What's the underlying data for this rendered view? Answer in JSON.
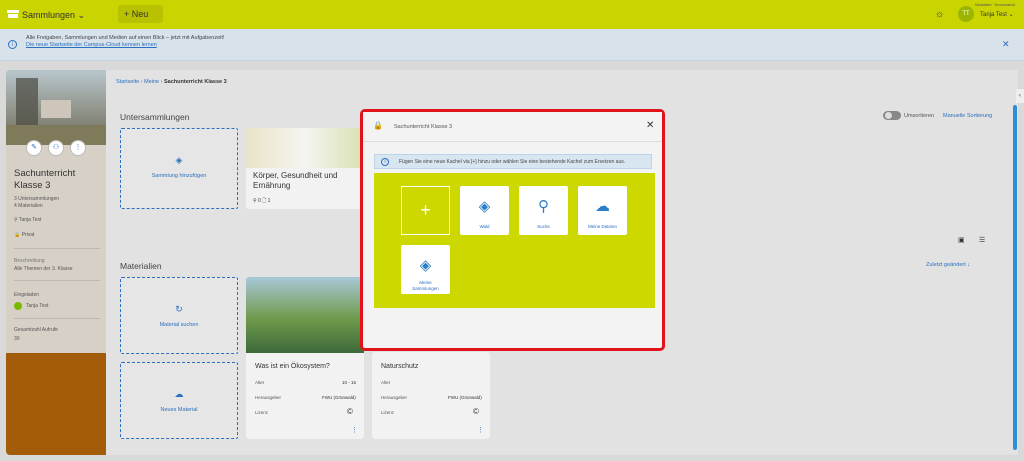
{
  "topbar": {
    "title": "Sammlungen ⌄",
    "new_label": "+  Neu",
    "user_initials": "TT",
    "user_name": "Tanja Test ⌄",
    "small_text": "Metadaten · Druckansicht"
  },
  "banner": {
    "line1": "Alle Freigaben, Sammlungen und Medien auf einen Blick – jetzt mit Aufgabenzeit!",
    "line2": "Die neue Startseite der Campus-Cloud kennen lernen"
  },
  "sidebar": {
    "title": "Sachunterricht Klasse 3",
    "counts": [
      "3 Untersammlungen",
      "4 Materialien"
    ],
    "owner": "Tanja Test",
    "visibility": "Privat",
    "description_label": "Beschreibung",
    "description": "Alle Themen der 3. Klasse",
    "invited_label": "Eingeladen",
    "invited_user": "Tanja Test",
    "views_label": "Gesamtzahl Aufrufe",
    "views": "30"
  },
  "breadcrumb": {
    "items": [
      "Startseite",
      "Meine"
    ],
    "current": "Sachunterricht Klasse 3"
  },
  "main": {
    "subcollections_heading": "Untersammlungen",
    "add_collection": "Sammlung hinzufügen",
    "tile1_title": "Körper, Gesundheit und Ernährung",
    "tile1_meta": "⚲ 0  🗋 1",
    "toggle_label": "Umsortieren",
    "manual_sort": "Manuelle Sortierung",
    "materials_heading": "Materialien",
    "material_search": "Material suchen",
    "new_material": "Neues Material",
    "sort_label": "Zuletzt geändert",
    "card1": {
      "title": "Was ist ein Ökosystem?",
      "age_label": "Alter",
      "age": "10 - 16",
      "publisher_label": "Herausgeber",
      "publisher": "FWU (Grünwald)",
      "license_label": "Lizenz"
    },
    "card2": {
      "title": "Naturschutz",
      "age_label": "Alter",
      "publisher_label": "Herausgeber",
      "publisher": "FWU (Grünwald)",
      "license_label": "Lizenz"
    }
  },
  "modal": {
    "title": "Sachunterricht Klasse 3",
    "info": "Fügen Sie eine neue Kachel via [+] hinzu oder wählen Sie eine bestehende Kachel zum Ersetzen aus.",
    "tiles": [
      "Wald",
      "Suche",
      "Meine Dateien",
      "Meine Sammlungen"
    ]
  }
}
